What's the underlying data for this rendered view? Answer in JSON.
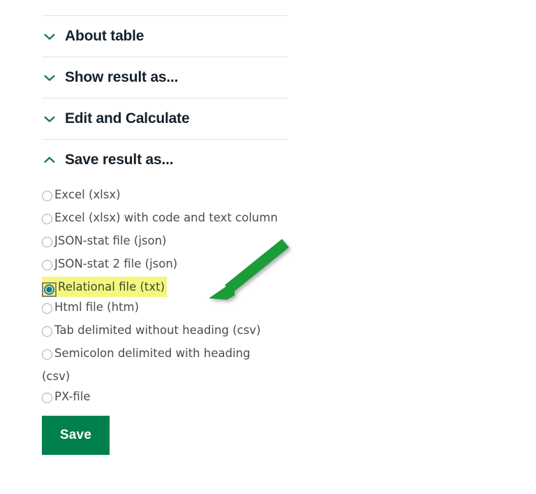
{
  "accordion": {
    "sections": [
      {
        "label": "About table",
        "icon": "chevron-down-icon",
        "expanded": false
      },
      {
        "label": "Show result as...",
        "icon": "chevron-down-icon",
        "expanded": false
      },
      {
        "label": "Edit and Calculate",
        "icon": "chevron-down-icon",
        "expanded": false
      },
      {
        "label": "Save result as...",
        "icon": "chevron-up-icon",
        "expanded": true
      }
    ]
  },
  "save_result_as": {
    "options": [
      {
        "label": "Excel (xlsx)",
        "selected": false
      },
      {
        "label": "Excel (xlsx) with code and text column",
        "selected": false
      },
      {
        "label": "JSON-stat file (json)",
        "selected": false
      },
      {
        "label": "JSON-stat 2 file (json)",
        "selected": false
      },
      {
        "label": "Relational file (txt)",
        "selected": true
      },
      {
        "label": "Html file (htm)",
        "selected": false
      },
      {
        "label": "Tab delimited without heading (csv)",
        "selected": false
      },
      {
        "label": "Semicolon delimited with heading (csv)",
        "selected": false
      },
      {
        "label": "PX-file",
        "selected": false
      }
    ],
    "save_label": "Save"
  },
  "annotation": {
    "arrow_icon": "arrow-pointing-to-selected-option",
    "color": "#1f9c39"
  },
  "colors": {
    "accent_green": "#00804a",
    "chevron_green": "#1b7a46",
    "highlight_yellow": "#f4f77e",
    "divider": "#d7e5ea",
    "heading_text": "#15202b",
    "option_text": "#4a4a55"
  }
}
